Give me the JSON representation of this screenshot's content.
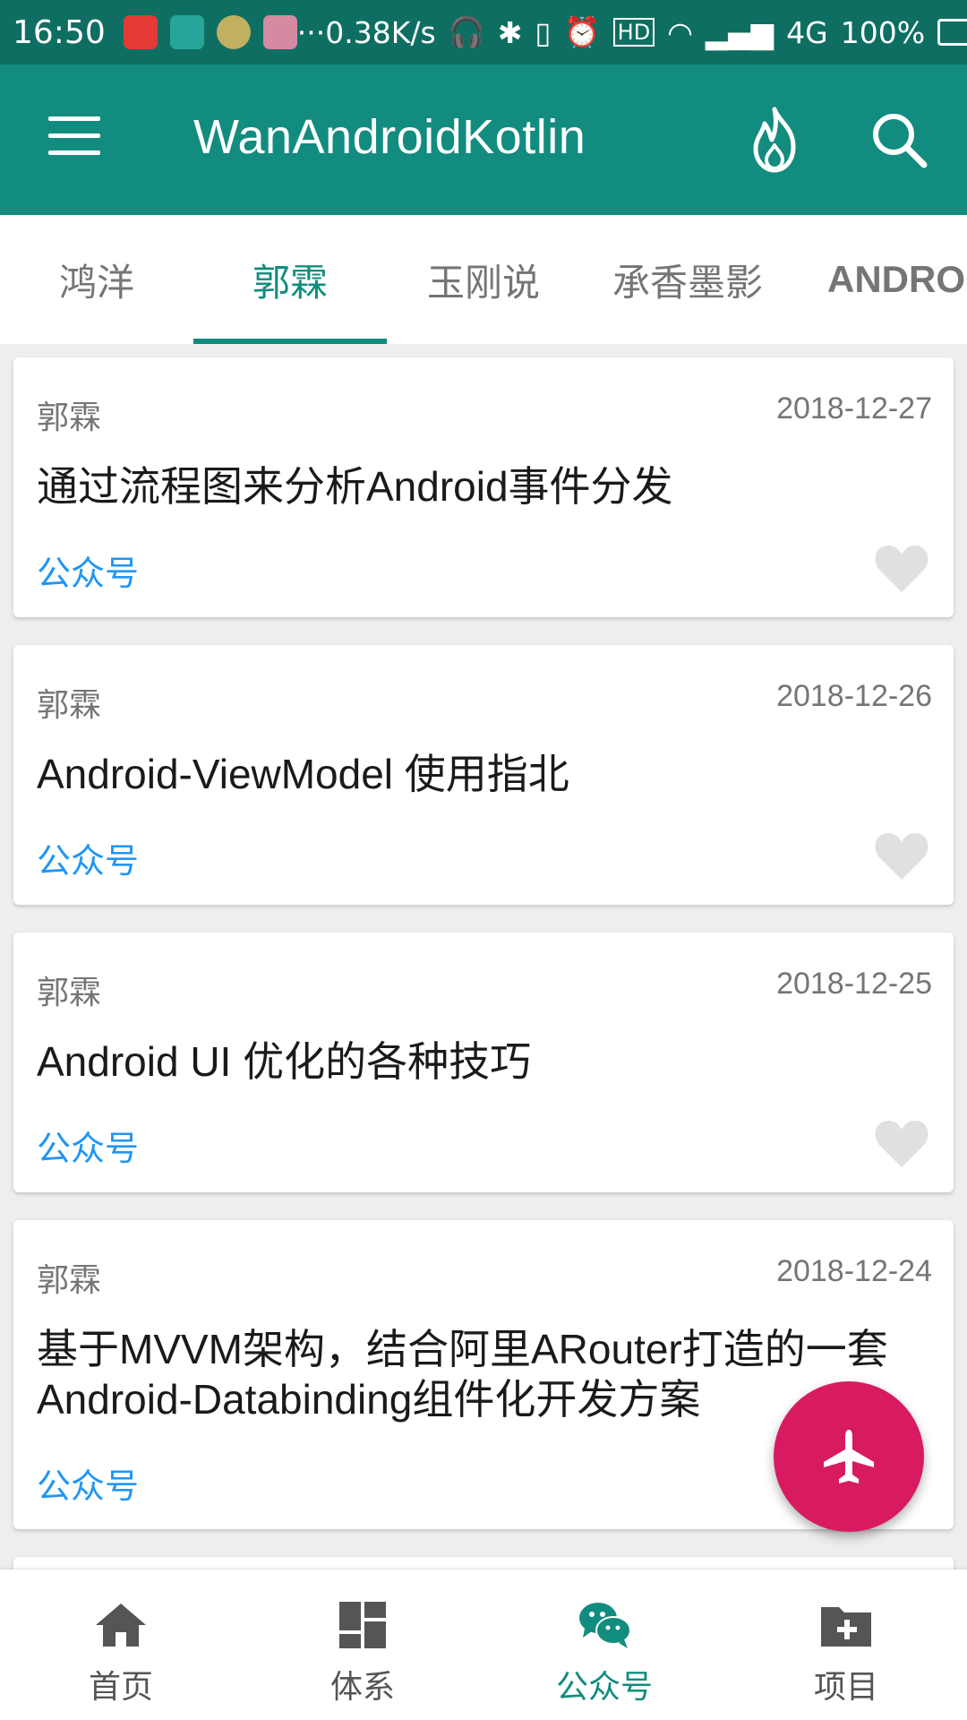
{
  "status_bar": {
    "time": "16:50",
    "speed": "···0.38K/s",
    "network": "4G",
    "battery": "100%"
  },
  "toolbar": {
    "title": "WanAndroidKotlin"
  },
  "tabs": [
    {
      "label": "鸿洋"
    },
    {
      "label": "郭霖"
    },
    {
      "label": "玉刚说"
    },
    {
      "label": "承香墨影"
    },
    {
      "label": "ANDROID"
    }
  ],
  "articles": [
    {
      "author": "郭霖",
      "date": "2018-12-27",
      "title": "通过流程图来分析Android事件分发",
      "tag": "公众号"
    },
    {
      "author": "郭霖",
      "date": "2018-12-26",
      "title": "Android-ViewModel 使用指北",
      "tag": "公众号"
    },
    {
      "author": "郭霖",
      "date": "2018-12-25",
      "title": "Android UI 优化的各种技巧",
      "tag": "公众号"
    },
    {
      "author": "郭霖",
      "date": "2018-12-24",
      "title": "基于MVVM架构，结合阿里ARouter打造的一套Android-Databinding组件化开发方案",
      "tag": "公众号"
    }
  ],
  "bottom_nav": [
    {
      "label": "首页"
    },
    {
      "label": "体系"
    },
    {
      "label": "公众号"
    },
    {
      "label": "项目"
    }
  ],
  "colors": {
    "primary": "#128c7e",
    "status_bar": "#0f6e62",
    "accent": "#d81b60",
    "tag": "#2196f3"
  }
}
